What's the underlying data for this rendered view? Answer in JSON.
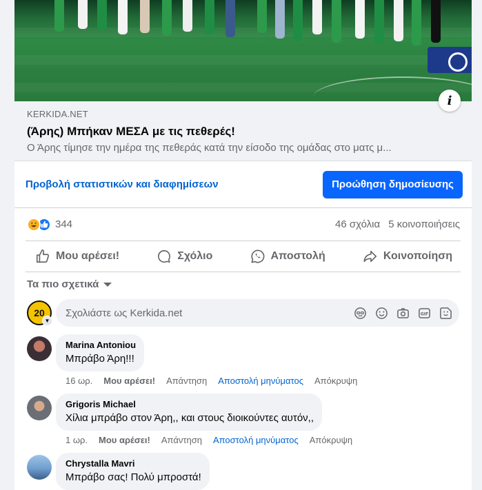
{
  "link_preview": {
    "domain": "KERKIDA.NET",
    "headline": "(Άρης) Μπήκαν ΜΕΣΑ με τις πεθερές!",
    "description": "Ο Άρης τίμησε την ημέρα της πεθεράς κατά την είσοδο της ομάδας στο ματς μ..."
  },
  "promo": {
    "insights_label": "Προβολή στατιστικών και διαφημίσεων",
    "boost_label": "Προώθηση δημοσίευσης"
  },
  "summary": {
    "reaction_count": "344",
    "comments": "46 σχόλια",
    "shares": "5 κοινοποιήσεις"
  },
  "actions": {
    "like": "Μου αρέσει!",
    "comment": "Σχόλιο",
    "send": "Αποστολή",
    "share": "Κοινοποίηση"
  },
  "sort_label": "Τα πιο σχετικά",
  "composer": {
    "placeholder": "Σχολιάστε ως Kerkida.net",
    "avatar_text": "20"
  },
  "comments": [
    {
      "author": "Marina Antoniou",
      "text": "Μπράβο Άρη!!!",
      "time": "16 ωρ.",
      "like": "Μου αρέσει!",
      "reply": "Απάντηση",
      "message": "Αποστολή μηνύματος",
      "hide": "Απόκρυψη"
    },
    {
      "author": "Grigoris Michael",
      "text": "Χίλια μπράβο στον Άρη,, και στους διοικούντες αυτόν,,",
      "time": "1 ωρ.",
      "like": "Μου αρέσει!",
      "reply": "Απάντηση",
      "message": "Αποστολή μηνύματος",
      "hide": "Απόκρυψη"
    },
    {
      "author": "Chrystalla Mavri",
      "text": "Μπράβο σας! Πολύ μπροστά!",
      "time": "",
      "like": "",
      "reply": "",
      "message": "",
      "hide": ""
    }
  ],
  "colors": {
    "accent": "#0866ff",
    "link": "#0064d1",
    "secondary_text": "#65676b",
    "surface": "#f0f2f5"
  },
  "icons": {
    "info": "info-icon",
    "like": "thumbs-up-icon",
    "comment": "speech-bubble-icon",
    "send": "whatsapp-icon",
    "share": "share-arrow-icon"
  }
}
